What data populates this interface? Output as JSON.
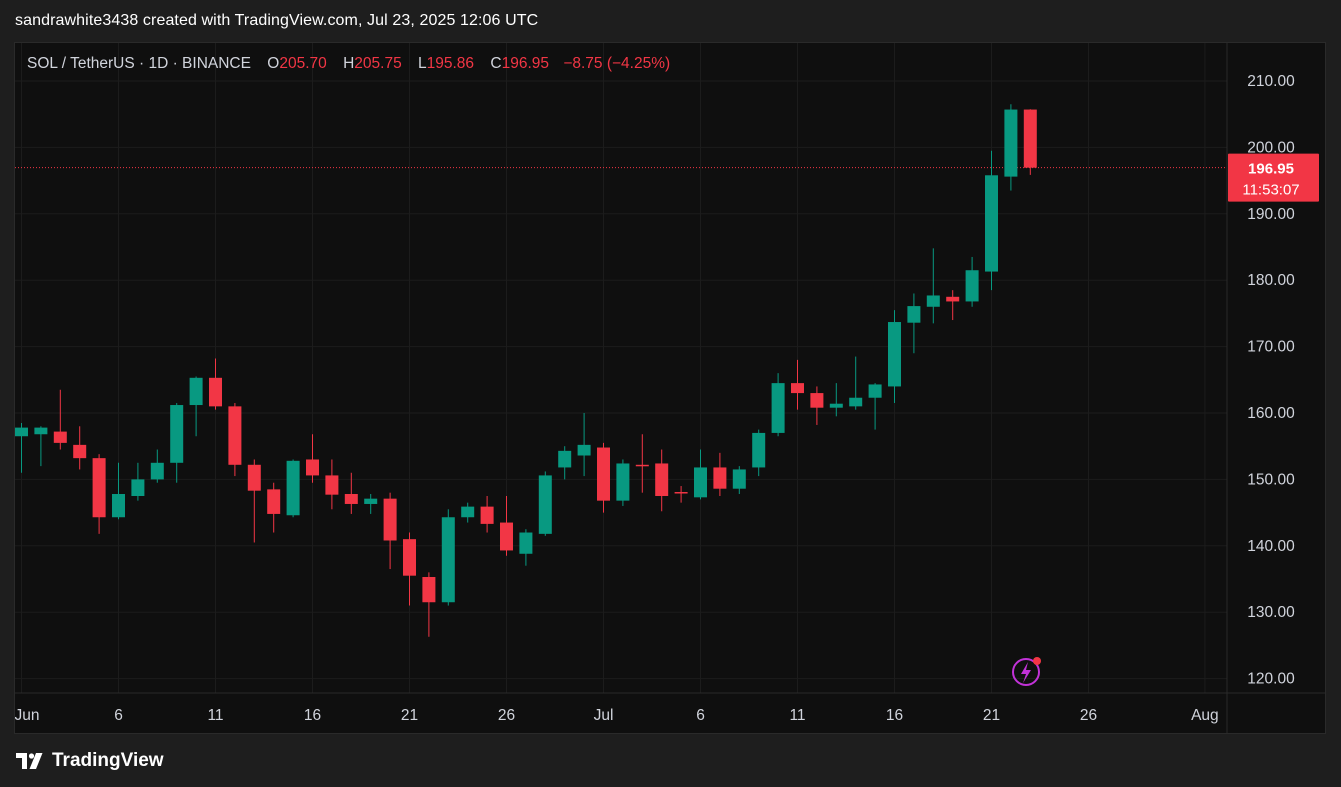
{
  "caption": "sandrawhite3438 created with TradingView.com, Jul 23, 2025 12:06 UTC",
  "legend": {
    "symbol": "SOL / TetherUS · 1D · BINANCE",
    "o_label": "O",
    "o_value": "205.70",
    "h_label": "H",
    "h_value": "205.75",
    "l_label": "L",
    "l_value": "195.86",
    "c_label": "C",
    "c_value": "196.95",
    "change": "−8.75 (−4.25%)"
  },
  "price_tag": {
    "price": "196.95",
    "countdown": "11:53:07"
  },
  "brand": "TradingView",
  "colors": {
    "up": "#089981",
    "down": "#f23645",
    "background": "#0f0f0f",
    "grid": "#1c1c1c",
    "tag": "#f23645",
    "indicator_icon": "#c232d8"
  },
  "icons": {
    "brand": "tradingview-logo-icon",
    "indicator": "lightning-indicator-icon"
  },
  "chart_data": {
    "type": "candlestick",
    "symbol": "SOL / TetherUS",
    "interval": "1D",
    "exchange": "BINANCE",
    "y_ticks": [
      "210.00",
      "200.00",
      "190.00",
      "180.00",
      "170.00",
      "160.00",
      "150.00",
      "140.00",
      "130.00",
      "120.00"
    ],
    "y_range": [
      117,
      215
    ],
    "x_ticks": [
      "Jun",
      "6",
      "11",
      "16",
      "21",
      "26",
      "Jul",
      "6",
      "11",
      "16",
      "21",
      "26",
      "Aug"
    ],
    "x_tick_days": [
      0,
      5,
      10,
      15,
      20,
      25,
      30,
      35,
      40,
      45,
      50,
      55,
      61
    ],
    "last_price_line": 196.95,
    "grid": true,
    "candles": [
      {
        "date": "Jun 1",
        "o": 156.5,
        "h": 158.5,
        "l": 151.0,
        "c": 157.8
      },
      {
        "date": "Jun 2",
        "o": 156.8,
        "h": 158.0,
        "l": 152.0,
        "c": 157.8
      },
      {
        "date": "Jun 3",
        "o": 157.2,
        "h": 163.5,
        "l": 154.5,
        "c": 155.5
      },
      {
        "date": "Jun 4",
        "o": 155.2,
        "h": 158.0,
        "l": 151.5,
        "c": 153.2
      },
      {
        "date": "Jun 5",
        "o": 153.2,
        "h": 153.8,
        "l": 141.8,
        "c": 144.3
      },
      {
        "date": "Jun 6",
        "o": 144.3,
        "h": 152.5,
        "l": 144.0,
        "c": 147.8
      },
      {
        "date": "Jun 7",
        "o": 147.5,
        "h": 152.5,
        "l": 146.8,
        "c": 150.0
      },
      {
        "date": "Jun 8",
        "o": 150.0,
        "h": 154.5,
        "l": 149.5,
        "c": 152.5
      },
      {
        "date": "Jun 9",
        "o": 152.5,
        "h": 161.5,
        "l": 149.5,
        "c": 161.2
      },
      {
        "date": "Jun 10",
        "o": 161.2,
        "h": 165.5,
        "l": 156.5,
        "c": 165.3
      },
      {
        "date": "Jun 11",
        "o": 165.3,
        "h": 168.2,
        "l": 160.5,
        "c": 161.0
      },
      {
        "date": "Jun 12",
        "o": 161.0,
        "h": 161.5,
        "l": 150.5,
        "c": 152.2
      },
      {
        "date": "Jun 13",
        "o": 152.2,
        "h": 153.0,
        "l": 140.5,
        "c": 148.3
      },
      {
        "date": "Jun 14",
        "o": 148.5,
        "h": 149.5,
        "l": 142.0,
        "c": 144.8
      },
      {
        "date": "Jun 15",
        "o": 144.6,
        "h": 153.0,
        "l": 144.3,
        "c": 152.8
      },
      {
        "date": "Jun 16",
        "o": 153.0,
        "h": 156.8,
        "l": 149.5,
        "c": 150.6
      },
      {
        "date": "Jun 17",
        "o": 150.6,
        "h": 153.0,
        "l": 145.5,
        "c": 147.7
      },
      {
        "date": "Jun 18",
        "o": 147.8,
        "h": 151.0,
        "l": 144.8,
        "c": 146.3
      },
      {
        "date": "Jun 19",
        "o": 146.3,
        "h": 147.8,
        "l": 144.8,
        "c": 147.1
      },
      {
        "date": "Jun 20",
        "o": 147.1,
        "h": 148.0,
        "l": 136.5,
        "c": 140.8
      },
      {
        "date": "Jun 21",
        "o": 141.0,
        "h": 142.0,
        "l": 131.0,
        "c": 135.5
      },
      {
        "date": "Jun 22",
        "o": 135.3,
        "h": 136.0,
        "l": 126.3,
        "c": 131.5
      },
      {
        "date": "Jun 23",
        "o": 131.5,
        "h": 145.5,
        "l": 131.0,
        "c": 144.3
      },
      {
        "date": "Jun 24",
        "o": 144.3,
        "h": 146.5,
        "l": 143.5,
        "c": 145.9
      },
      {
        "date": "Jun 25",
        "o": 145.9,
        "h": 147.5,
        "l": 142.0,
        "c": 143.3
      },
      {
        "date": "Jun 26",
        "o": 143.5,
        "h": 147.5,
        "l": 138.5,
        "c": 139.3
      },
      {
        "date": "Jun 27",
        "o": 138.8,
        "h": 142.5,
        "l": 137.0,
        "c": 142.0
      },
      {
        "date": "Jun 28",
        "o": 141.8,
        "h": 151.2,
        "l": 141.5,
        "c": 150.6
      },
      {
        "date": "Jun 29",
        "o": 151.8,
        "h": 155.0,
        "l": 150.0,
        "c": 154.3
      },
      {
        "date": "Jun 30",
        "o": 153.6,
        "h": 160.0,
        "l": 150.5,
        "c": 155.2
      },
      {
        "date": "Jul 1",
        "o": 154.8,
        "h": 155.5,
        "l": 145.0,
        "c": 146.8
      },
      {
        "date": "Jul 2",
        "o": 146.8,
        "h": 153.0,
        "l": 146.0,
        "c": 152.4
      },
      {
        "date": "Jul 3",
        "o": 152.2,
        "h": 156.8,
        "l": 148.0,
        "c": 152.0
      },
      {
        "date": "Jul 4",
        "o": 152.4,
        "h": 154.5,
        "l": 145.2,
        "c": 147.5
      },
      {
        "date": "Jul 5",
        "o": 148.1,
        "h": 149.0,
        "l": 146.5,
        "c": 148.0
      },
      {
        "date": "Jul 6",
        "o": 147.3,
        "h": 154.5,
        "l": 147.0,
        "c": 151.8
      },
      {
        "date": "Jul 7",
        "o": 151.8,
        "h": 154.0,
        "l": 147.5,
        "c": 148.6
      },
      {
        "date": "Jul 8",
        "o": 148.6,
        "h": 152.0,
        "l": 147.8,
        "c": 151.5
      },
      {
        "date": "Jul 9",
        "o": 151.8,
        "h": 157.5,
        "l": 150.5,
        "c": 157.0
      },
      {
        "date": "Jul 10",
        "o": 157.0,
        "h": 166.0,
        "l": 156.5,
        "c": 164.5
      },
      {
        "date": "Jul 11",
        "o": 164.5,
        "h": 168.0,
        "l": 160.5,
        "c": 163.0
      },
      {
        "date": "Jul 12",
        "o": 163.0,
        "h": 164.0,
        "l": 158.2,
        "c": 160.8
      },
      {
        "date": "Jul 13",
        "o": 160.8,
        "h": 164.5,
        "l": 159.5,
        "c": 161.4
      },
      {
        "date": "Jul 14",
        "o": 161.0,
        "h": 168.5,
        "l": 160.5,
        "c": 162.3
      },
      {
        "date": "Jul 15",
        "o": 162.3,
        "h": 164.5,
        "l": 157.5,
        "c": 164.3
      },
      {
        "date": "Jul 16",
        "o": 164.0,
        "h": 175.5,
        "l": 161.5,
        "c": 173.7
      },
      {
        "date": "Jul 17",
        "o": 173.6,
        "h": 178.0,
        "l": 169.0,
        "c": 176.1
      },
      {
        "date": "Jul 18",
        "o": 176.0,
        "h": 184.8,
        "l": 173.5,
        "c": 177.7
      },
      {
        "date": "Jul 19",
        "o": 177.5,
        "h": 178.5,
        "l": 174.0,
        "c": 176.8
      },
      {
        "date": "Jul 20",
        "o": 176.8,
        "h": 183.5,
        "l": 176.0,
        "c": 181.5
      },
      {
        "date": "Jul 21",
        "o": 181.3,
        "h": 199.5,
        "l": 178.5,
        "c": 195.8
      },
      {
        "date": "Jul 22",
        "o": 195.6,
        "h": 206.5,
        "l": 193.5,
        "c": 205.7
      },
      {
        "date": "Jul 23",
        "o": 205.7,
        "h": 205.75,
        "l": 195.86,
        "c": 196.95
      }
    ]
  }
}
